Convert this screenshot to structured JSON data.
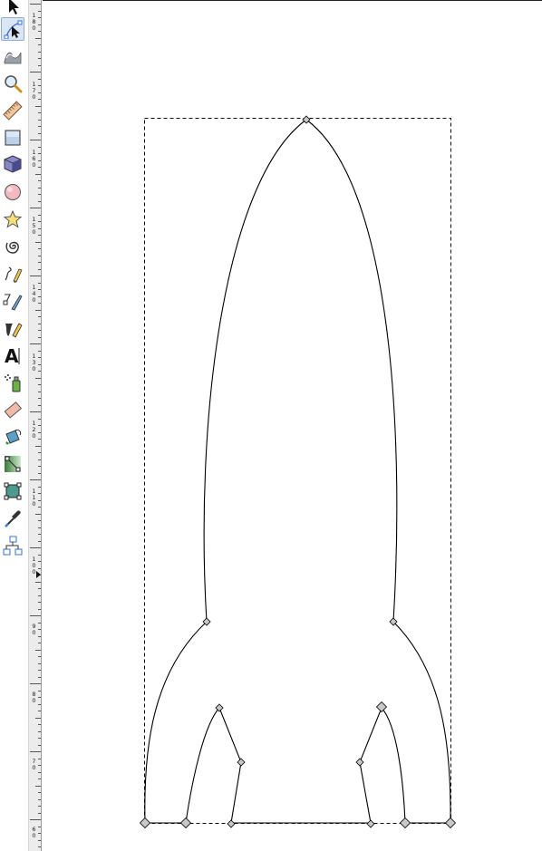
{
  "toolbox": {
    "tools": [
      {
        "id": "selector",
        "icon": "arrow-icon",
        "active": false
      },
      {
        "id": "node-editor",
        "icon": "node-edit-icon",
        "active": true
      },
      {
        "id": "tweak",
        "icon": "tweak-wave-icon",
        "active": false
      },
      {
        "id": "zoom",
        "icon": "magnifier-icon",
        "active": false
      },
      {
        "id": "measure",
        "icon": "ruler-icon",
        "active": false
      },
      {
        "id": "rectangle",
        "icon": "rectangle-icon",
        "active": false
      },
      {
        "id": "3d-box",
        "icon": "cube-icon",
        "active": false
      },
      {
        "id": "ellipse",
        "icon": "circle-icon",
        "active": false
      },
      {
        "id": "star",
        "icon": "star-icon",
        "active": false
      },
      {
        "id": "spiral",
        "icon": "spiral-icon",
        "active": false
      },
      {
        "id": "pencil",
        "icon": "pencil-icon",
        "active": false
      },
      {
        "id": "pen",
        "icon": "pen-icon",
        "active": false
      },
      {
        "id": "calligraphy",
        "icon": "calligraphy-icon",
        "active": false
      },
      {
        "id": "text",
        "icon": "text-icon",
        "active": false,
        "glyph": "A"
      },
      {
        "id": "spray",
        "icon": "spray-icon",
        "active": false
      },
      {
        "id": "eraser",
        "icon": "eraser-icon",
        "active": false
      },
      {
        "id": "paint-bucket",
        "icon": "paint-bucket-icon",
        "active": false
      },
      {
        "id": "gradient",
        "icon": "gradient-icon",
        "active": false
      },
      {
        "id": "mesh",
        "icon": "mesh-icon",
        "active": false
      },
      {
        "id": "dropper",
        "icon": "dropper-icon",
        "active": false
      },
      {
        "id": "connector",
        "icon": "connector-icon",
        "active": false
      }
    ]
  },
  "ruler": {
    "orientation": "vertical",
    "labels": [
      "180",
      "170",
      "160",
      "150",
      "140",
      "130",
      "120",
      "110",
      "100",
      "90",
      "80",
      "70",
      "60"
    ]
  },
  "canvas": {
    "background": "#ffffff",
    "path_stroke": "#000000",
    "node_fill": "#c8c8c8",
    "bbox_stroke": "#000000",
    "tool_accent": "#4f7fd1"
  }
}
